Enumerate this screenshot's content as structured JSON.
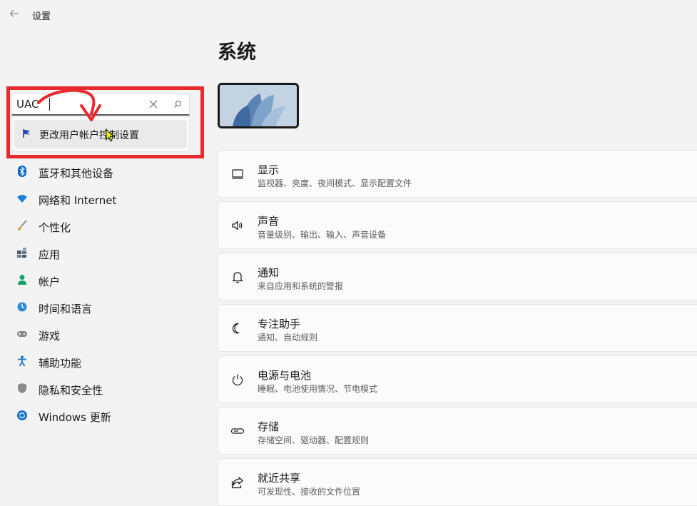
{
  "window": {
    "title": "设置"
  },
  "search": {
    "value": "UAC",
    "suggestion": "更改用户帐户控制设置"
  },
  "sidebar": {
    "items": [
      {
        "label": "蓝牙和其他设备",
        "icon": "bluetooth-icon"
      },
      {
        "label": "网络和 Internet",
        "icon": "wifi-icon"
      },
      {
        "label": "个性化",
        "icon": "brush-icon"
      },
      {
        "label": "应用",
        "icon": "apps-icon"
      },
      {
        "label": "帐户",
        "icon": "person-icon"
      },
      {
        "label": "时间和语言",
        "icon": "globe-clock-icon"
      },
      {
        "label": "游戏",
        "icon": "gamepad-icon"
      },
      {
        "label": "辅助功能",
        "icon": "accessibility-icon"
      },
      {
        "label": "隐私和安全性",
        "icon": "shield-icon"
      },
      {
        "label": "Windows 更新",
        "icon": "update-icon"
      }
    ]
  },
  "main": {
    "title": "系统",
    "cards": [
      {
        "title": "显示",
        "subtitle": "监视器、亮度、夜间模式、显示配置文件",
        "icon": "monitor-icon"
      },
      {
        "title": "声音",
        "subtitle": "音量级别、输出、输入、声音设备",
        "icon": "speaker-icon"
      },
      {
        "title": "通知",
        "subtitle": "来自应用和系统的警报",
        "icon": "bell-icon"
      },
      {
        "title": "专注助手",
        "subtitle": "通知、自动规则",
        "icon": "moon-icon"
      },
      {
        "title": "电源与电池",
        "subtitle": "睡眠、电池使用情况、节电模式",
        "icon": "power-icon"
      },
      {
        "title": "存储",
        "subtitle": "存储空间、驱动器、配置规则",
        "icon": "storage-icon"
      },
      {
        "title": "就近共享",
        "subtitle": "可发现性、接收的文件位置",
        "icon": "share-icon"
      }
    ]
  },
  "colors": {
    "highlight": "#e8292d",
    "accent": "#0067c0",
    "background": "#f3f3f3"
  }
}
